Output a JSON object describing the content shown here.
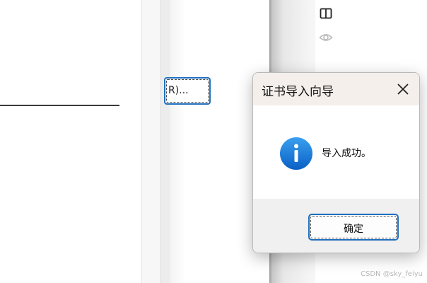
{
  "background": {
    "browse_button_label": "R)..."
  },
  "toolbar": {
    "icons": [
      "reader-view-icon",
      "eye-icon"
    ]
  },
  "dialog": {
    "title": "证书导入向导",
    "message": "导入成功。",
    "ok_label": "确定",
    "icon": "info-icon",
    "close_icon": "close-icon",
    "accent_color": "#1f6fbf"
  },
  "watermark": "CSDN @sky_feiyu"
}
